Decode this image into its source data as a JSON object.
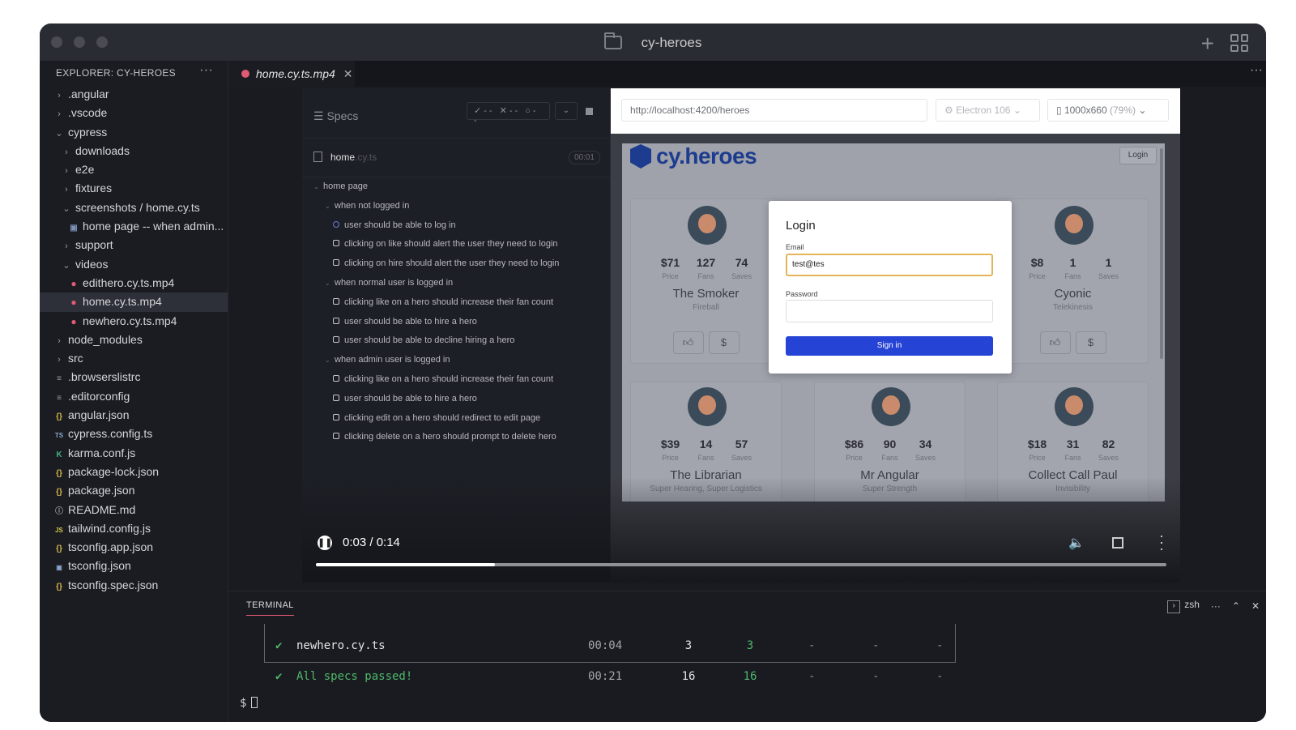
{
  "window": {
    "title": "cy-heroes"
  },
  "explorer": {
    "header": "EXPLORER: CY-HEROES",
    "more": "···",
    "items": [
      {
        "label": ".angular",
        "chev": "›",
        "icon": "",
        "indent": 0
      },
      {
        "label": ".vscode",
        "chev": "›",
        "icon": "",
        "indent": 0
      },
      {
        "label": "cypress",
        "chev": "⌄",
        "icon": "",
        "indent": 0
      },
      {
        "label": "downloads",
        "chev": "›",
        "icon": "",
        "indent": 1
      },
      {
        "label": "e2e",
        "chev": "›",
        "icon": "",
        "indent": 1
      },
      {
        "label": "fixtures",
        "chev": "›",
        "icon": "",
        "indent": 1
      },
      {
        "label": "screenshots / home.cy.ts",
        "chev": "⌄",
        "icon": "",
        "indent": 1
      },
      {
        "label": "home page -- when admin...",
        "chev": "",
        "icon": "img",
        "indent": 2
      },
      {
        "label": "support",
        "chev": "›",
        "icon": "",
        "indent": 1
      },
      {
        "label": "videos",
        "chev": "⌄",
        "icon": "",
        "indent": 1
      },
      {
        "label": "edithero.cy.ts.mp4",
        "chev": "",
        "icon": "vid",
        "indent": 2
      },
      {
        "label": "home.cy.ts.mp4",
        "chev": "",
        "icon": "vid",
        "indent": 2,
        "selected": true
      },
      {
        "label": "newhero.cy.ts.mp4",
        "chev": "",
        "icon": "vid",
        "indent": 2
      },
      {
        "label": "node_modules",
        "chev": "›",
        "icon": "",
        "indent": 0
      },
      {
        "label": "src",
        "chev": "›",
        "icon": "",
        "indent": 0
      },
      {
        "label": ".browserslistrc",
        "chev": "",
        "icon": "lines",
        "indent": 0
      },
      {
        "label": ".editorconfig",
        "chev": "",
        "icon": "lines",
        "indent": 0
      },
      {
        "label": "angular.json",
        "chev": "",
        "icon": "json",
        "indent": 0
      },
      {
        "label": "cypress.config.ts",
        "chev": "",
        "icon": "ts",
        "indent": 0
      },
      {
        "label": "karma.conf.js",
        "chev": "",
        "icon": "k",
        "indent": 0
      },
      {
        "label": "package-lock.json",
        "chev": "",
        "icon": "json",
        "indent": 0
      },
      {
        "label": "package.json",
        "chev": "",
        "icon": "json",
        "indent": 0
      },
      {
        "label": "README.md",
        "chev": "",
        "icon": "info",
        "indent": 0
      },
      {
        "label": "tailwind.config.js",
        "chev": "",
        "icon": "js",
        "indent": 0
      },
      {
        "label": "tsconfig.app.json",
        "chev": "",
        "icon": "json",
        "indent": 0
      },
      {
        "label": "tsconfig.json",
        "chev": "",
        "icon": "tsjson",
        "indent": 0
      },
      {
        "label": "tsconfig.spec.json",
        "chev": "",
        "icon": "json",
        "indent": 0
      }
    ]
  },
  "tab": {
    "label": "home.cy.ts.mp4",
    "close": "✕"
  },
  "specs": {
    "label": "Specs",
    "controls": "✓-- ✕-- ○--",
    "file": {
      "name": "home",
      "ext": ".cy.ts",
      "time": "00:01"
    },
    "rows": [
      {
        "level": 0,
        "kind": "suite",
        "text": "home page"
      },
      {
        "level": 1,
        "kind": "suite",
        "text": "when not logged in"
      },
      {
        "level": 2,
        "kind": "running",
        "text": "user should be able to log in"
      },
      {
        "level": 2,
        "kind": "test",
        "text": "clicking on like should alert the user they need to login"
      },
      {
        "level": 2,
        "kind": "test",
        "text": "clicking on hire should alert the user they need to login"
      },
      {
        "level": 1,
        "kind": "suite",
        "text": "when normal user is logged in"
      },
      {
        "level": 2,
        "kind": "test",
        "text": "clicking like on a hero should increase their fan count"
      },
      {
        "level": 2,
        "kind": "test",
        "text": "user should be able to hire a hero"
      },
      {
        "level": 2,
        "kind": "test",
        "text": "user should be able to decline hiring a hero"
      },
      {
        "level": 1,
        "kind": "suite",
        "text": "when admin user is logged in"
      },
      {
        "level": 2,
        "kind": "test",
        "text": "clicking like on a hero should increase their fan count"
      },
      {
        "level": 2,
        "kind": "test",
        "text": "user should be able to hire a hero"
      },
      {
        "level": 2,
        "kind": "test",
        "text": "clicking edit on a hero should redirect to edit page"
      },
      {
        "level": 2,
        "kind": "test",
        "text": "clicking delete on a hero should prompt to delete hero"
      }
    ]
  },
  "browser": {
    "url": "http://localhost:4200/heroes",
    "engine": "Electron 106",
    "viewport": "1000x660",
    "scale": "(79%)"
  },
  "app": {
    "logo": "cy.heroes",
    "login_button": "Login",
    "stat_labels": [
      "Price",
      "Fans",
      "Saves"
    ],
    "heroes": [
      {
        "price": "$71",
        "fans": "127",
        "saves": "74",
        "name": "The Smoker",
        "power": "Fireball"
      },
      {
        "price": "$8",
        "fans": "1",
        "saves": "1",
        "name": "Cyonic",
        "power": "Telekinesis"
      },
      {
        "price": "$39",
        "fans": "14",
        "saves": "57",
        "name": "The Librarian",
        "power": "Super Hearing, Super Logistics"
      },
      {
        "price": "$86",
        "fans": "90",
        "saves": "34",
        "name": "Mr Angular",
        "power": "Super Strength"
      },
      {
        "price": "$18",
        "fans": "31",
        "saves": "82",
        "name": "Collect Call Paul",
        "power": "Invisibility"
      }
    ],
    "modal": {
      "title": "Login",
      "email_label": "Email",
      "email_value": "test@tes",
      "password_label": "Password",
      "sign_in": "Sign in"
    }
  },
  "player": {
    "time": "0:03 / 0:14",
    "progress": 0.21
  },
  "terminal": {
    "tab": "TERMINAL",
    "shell": "zsh",
    "rows": [
      {
        "check": "✔",
        "name": "newhero.cy.ts",
        "duration": "00:04",
        "tests": "3",
        "passing": "3",
        "failing": "-",
        "pending": "-",
        "skipped": "-"
      },
      {
        "check": "✔",
        "name": "All specs passed!",
        "duration": "00:21",
        "tests": "16",
        "passing": "16",
        "failing": "-",
        "pending": "-",
        "skipped": "-"
      }
    ],
    "prompt": "$"
  }
}
